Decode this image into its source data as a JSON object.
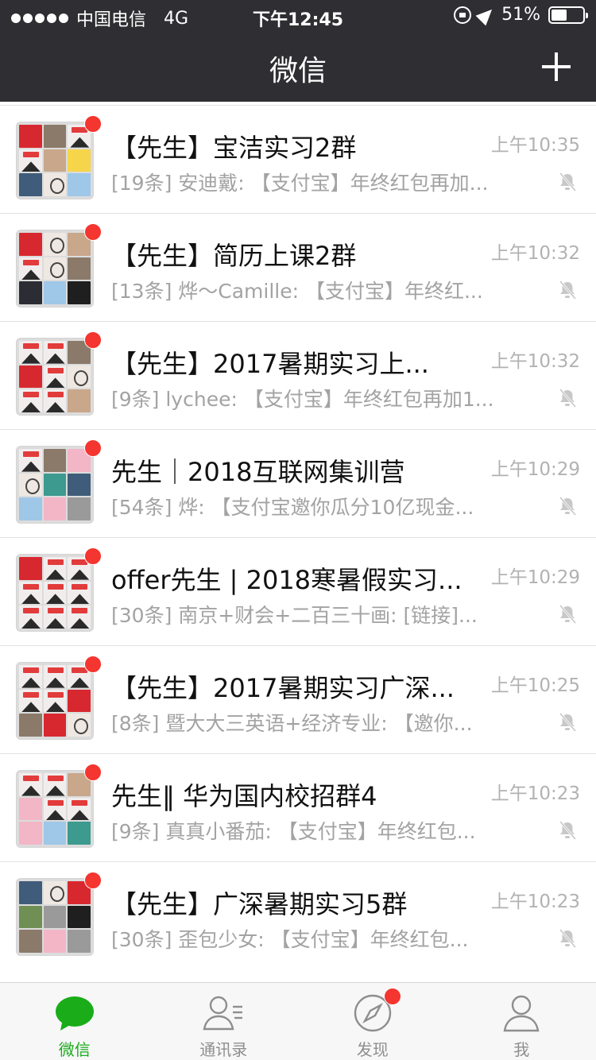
{
  "status_bar": {
    "carrier": "中国电信",
    "network": "4G",
    "time": "下午12:45",
    "battery": "51%",
    "battery_level": 0.51
  },
  "nav": {
    "title": "微信",
    "add_icon": "plus-icon"
  },
  "chats": [
    {
      "title": "【先生】宝洁实习2群",
      "time": "上午10:35",
      "preview": "[19条] 安迪戴: 【支付宝】年终红包再加...",
      "unread": true,
      "muted": true
    },
    {
      "title": "【先生】简历上课2群",
      "time": "上午10:32",
      "preview": "[13条] 烨～Camille: 【支付宝】年终红...",
      "unread": true,
      "muted": true
    },
    {
      "title": "【先生】2017暑期实习上...",
      "time": "上午10:32",
      "preview": "[9条] lychee: 【支付宝】年终红包再加1...",
      "unread": true,
      "muted": true
    },
    {
      "title": "先生｜2018互联网集训营",
      "time": "上午10:29",
      "preview": "[54条] 烨: 【支付宝邀你瓜分10亿现金...",
      "unread": true,
      "muted": true
    },
    {
      "title": "offer先生 | 2018寒暑假实习...",
      "time": "上午10:29",
      "preview": "[30条] 南京+财会+二百三十画: [链接]...",
      "unread": true,
      "muted": true
    },
    {
      "title": "【先生】2017暑期实习广深...",
      "time": "上午10:25",
      "preview": "[8条] 暨大大三英语+经济专业: 【邀你...",
      "unread": true,
      "muted": true
    },
    {
      "title": "先生‖ 华为国内校招群4",
      "time": "上午10:23",
      "preview": "[9条] 真真小番茄: 【支付宝】年终红包...",
      "unread": true,
      "muted": true
    },
    {
      "title": "【先生】广深暑期实习5群",
      "time": "上午10:23",
      "preview": "[30条] 歪包少女: 【支付宝】年终红包...",
      "unread": true,
      "muted": true
    }
  ],
  "tabs": [
    {
      "label": "微信",
      "icon": "chat-bubble-icon",
      "active": true,
      "badge": false
    },
    {
      "label": "通讯录",
      "icon": "contacts-icon",
      "active": false,
      "badge": false
    },
    {
      "label": "发现",
      "icon": "compass-icon",
      "active": false,
      "badge": true
    },
    {
      "label": "我",
      "icon": "person-icon",
      "active": false,
      "badge": false
    }
  ],
  "colors": {
    "nav_bg": "#2f2f33",
    "accent_green": "#1aad19",
    "badge_red": "#f43530",
    "muted_grey": "#b2b2b2"
  }
}
